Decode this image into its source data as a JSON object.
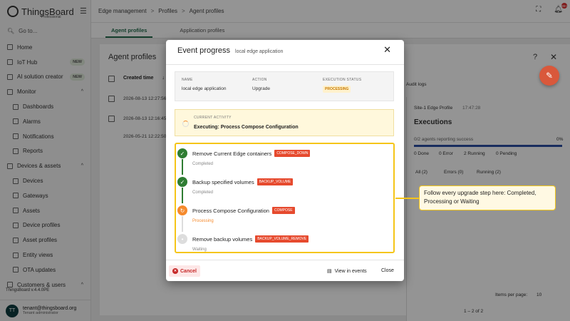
{
  "app": {
    "brand": "ThingsBoard",
    "edition": "Professional",
    "version": "ThingsBoard v.4.4.0PE"
  },
  "sidebar": {
    "goto": "Go to...",
    "items": [
      {
        "label": "Home",
        "icon": "home-icon"
      },
      {
        "label": "IoT Hub",
        "icon": "hub-icon",
        "badge": "NEW"
      },
      {
        "label": "AI solution creator",
        "icon": "sparkle-icon",
        "badge": "NEW"
      },
      {
        "label": "Monitor",
        "icon": "monitor-icon",
        "chevron": "^"
      },
      {
        "label": "Dashboards",
        "icon": "dashboard-icon",
        "sub": true
      },
      {
        "label": "Alarms",
        "icon": "alarm-icon",
        "sub": true
      },
      {
        "label": "Notifications",
        "icon": "notification-icon",
        "sub": true
      },
      {
        "label": "Reports",
        "icon": "report-icon",
        "sub": true
      },
      {
        "label": "Devices & assets",
        "icon": "devices-icon",
        "chevron": "^"
      },
      {
        "label": "Devices",
        "icon": "device-icon",
        "sub": true
      },
      {
        "label": "Gateways",
        "icon": "gateway-icon",
        "sub": true
      },
      {
        "label": "Assets",
        "icon": "asset-icon",
        "sub": true
      },
      {
        "label": "Device profiles",
        "icon": "device-profile-icon",
        "sub": true
      },
      {
        "label": "Asset profiles",
        "icon": "asset-profile-icon",
        "sub": true
      },
      {
        "label": "Entity views",
        "icon": "entity-view-icon",
        "sub": true
      },
      {
        "label": "OTA updates",
        "icon": "ota-icon",
        "sub": true
      },
      {
        "label": "Customers & users",
        "icon": "users-icon",
        "chevron": "^"
      }
    ],
    "user": {
      "initials": "TT",
      "email": "tenant@thingsboard.org",
      "role": "Tenant administrator"
    }
  },
  "breadcrumb": {
    "items": [
      "Edge management",
      "Profiles",
      "Agent profiles"
    ],
    "sep": ">"
  },
  "notifications_count": "99+",
  "tabs": [
    "Agent profiles",
    "Application profiles"
  ],
  "agent_profiles": {
    "title": "Agent profiles",
    "col_created": "Created time",
    "rows": [
      "2026-08-13 12:27:56",
      "2026-08-13 12:16:45",
      "2026-05-21 12:22:50"
    ]
  },
  "right_panel": {
    "audit": "Audit logs",
    "crumb": "Site-1 Edge Profile",
    "time": "17:47:28",
    "title": "Executions",
    "summary": "0/2 agents reporting success",
    "percent": "0%",
    "legend": [
      "0 Done",
      "0 Error",
      "2 Running",
      "0 Pending"
    ],
    "filters": [
      "All (2)",
      "Errors (0)",
      "Running (2)"
    ],
    "items_per_page_label": "Items per page:",
    "items_per_page": "10",
    "range": "1 – 2 of 2"
  },
  "dialog": {
    "title": "Event progress",
    "subtitle": "local edge application",
    "info": {
      "name_h": "NAME",
      "name_v": "local edge application",
      "action_h": "ACTION",
      "action_v": "Upgrade",
      "status_h": "EXECUTION STATUS",
      "status_v": "PROCESSING"
    },
    "activity": {
      "header": "CURRENT ACTIVITY",
      "value": "Executing: Process Compose Configuration"
    },
    "steps": [
      {
        "title": "Remove Current Edge containers",
        "tag": "COMPOSE_DOWN",
        "status": "Completed",
        "state": "done"
      },
      {
        "title": "Backup specified volumes",
        "tag": "BACKUP_VOLUME",
        "status": "Completed",
        "state": "done"
      },
      {
        "title": "Process Compose Configuration",
        "tag": "COMPOSE",
        "status": "Processing",
        "state": "proc"
      },
      {
        "title": "Remove backup volumes",
        "tag": "BACKUP_VOLUME_REMOVE",
        "status": "Waiting",
        "state": "wait"
      }
    ],
    "cancel": "Cancel",
    "view_events": "View in events",
    "close": "Close"
  },
  "callout": "Follow every upgrade step here: Completed, Processing or Waiting",
  "colors": {
    "primary": "#236b4c",
    "accent": "#e64a2e",
    "highlight": "#f5c518",
    "done": "#2e7d32",
    "processing": "#f58a2c"
  }
}
